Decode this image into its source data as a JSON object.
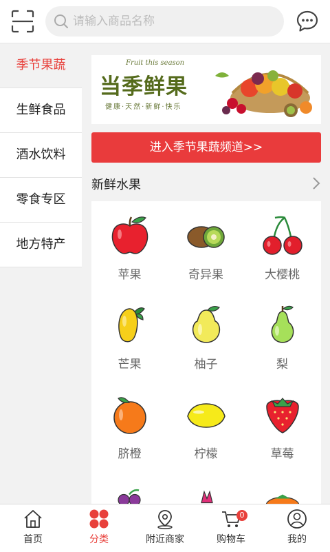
{
  "header": {
    "search_placeholder": "请输入商品名称",
    "icons": {
      "scan": "scan-icon",
      "search": "search-icon",
      "message": "chat-bubble-icon"
    }
  },
  "sidebar": {
    "items": [
      {
        "label": "季节果蔬",
        "active": true
      },
      {
        "label": "生鲜食品",
        "active": false
      },
      {
        "label": "酒水饮料",
        "active": false
      },
      {
        "label": "零食专区",
        "active": false
      },
      {
        "label": "地方特产",
        "active": false
      }
    ]
  },
  "banner": {
    "script_text": "Fruit this season",
    "title": "当季鲜果",
    "subtitle": "健康·天然·新鲜·快乐"
  },
  "enter_button": "进入季节果蔬频道>>",
  "section": {
    "title": "新鲜水果"
  },
  "fruits": [
    {
      "label": "苹果",
      "icon": "apple-icon"
    },
    {
      "label": "奇异果",
      "icon": "kiwi-icon"
    },
    {
      "label": "大樱桃",
      "icon": "cherry-icon"
    },
    {
      "label": "芒果",
      "icon": "mango-icon"
    },
    {
      "label": "柚子",
      "icon": "pomelo-icon"
    },
    {
      "label": "梨",
      "icon": "pear-icon"
    },
    {
      "label": "脐橙",
      "icon": "orange-icon"
    },
    {
      "label": "柠檬",
      "icon": "lemon-icon"
    },
    {
      "label": "草莓",
      "icon": "strawberry-icon"
    }
  ],
  "tabbar": {
    "items": [
      {
        "label": "首页",
        "icon": "home-icon",
        "active": false
      },
      {
        "label": "分类",
        "icon": "category-icon",
        "active": true
      },
      {
        "label": "附近商家",
        "icon": "location-pin-icon",
        "active": false
      },
      {
        "label": "购物车",
        "icon": "cart-icon",
        "active": false,
        "badge": "0"
      },
      {
        "label": "我的",
        "icon": "user-icon",
        "active": false
      }
    ]
  },
  "colors": {
    "accent": "#e8403b",
    "button": "#e93b3c",
    "background": "#f2f2f2"
  }
}
